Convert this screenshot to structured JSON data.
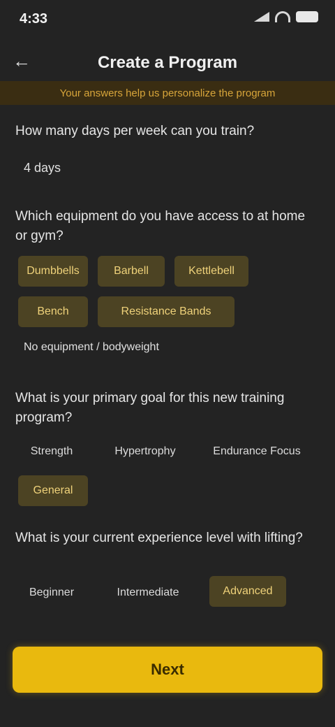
{
  "status": {
    "time": "4:33"
  },
  "header": {
    "title": "Create a Program"
  },
  "notice": "Your answers help us personalize the program",
  "questions": [
    {
      "text": "How many days per week can you train?",
      "answer": "4 days"
    },
    {
      "text": "Which equipment do you have access to at home or gym?",
      "options": [
        {
          "label": "Dumbbells",
          "selected": true
        },
        {
          "label": "Barbell",
          "selected": true
        },
        {
          "label": "Kettlebell",
          "selected": true
        },
        {
          "label": "Bench",
          "selected": true
        },
        {
          "label": "Resistance Bands",
          "selected": true
        }
      ],
      "other_text": "No equipment / bodyweight"
    },
    {
      "text": "What is your primary goal for this new training program?",
      "options": [
        {
          "label": "Strength",
          "selected": false
        },
        {
          "label": "Hypertrophy",
          "selected": false
        },
        {
          "label": "Endurance Focus",
          "selected": false
        },
        {
          "label": "General",
          "selected": true
        }
      ]
    },
    {
      "text": "What is your current experience level with lifting?",
      "options": [
        {
          "label": "Beginner",
          "selected": false
        },
        {
          "label": "Intermediate",
          "selected": false
        },
        {
          "label": "Advanced",
          "selected": true
        }
      ]
    }
  ],
  "cta": {
    "label": "Next"
  }
}
